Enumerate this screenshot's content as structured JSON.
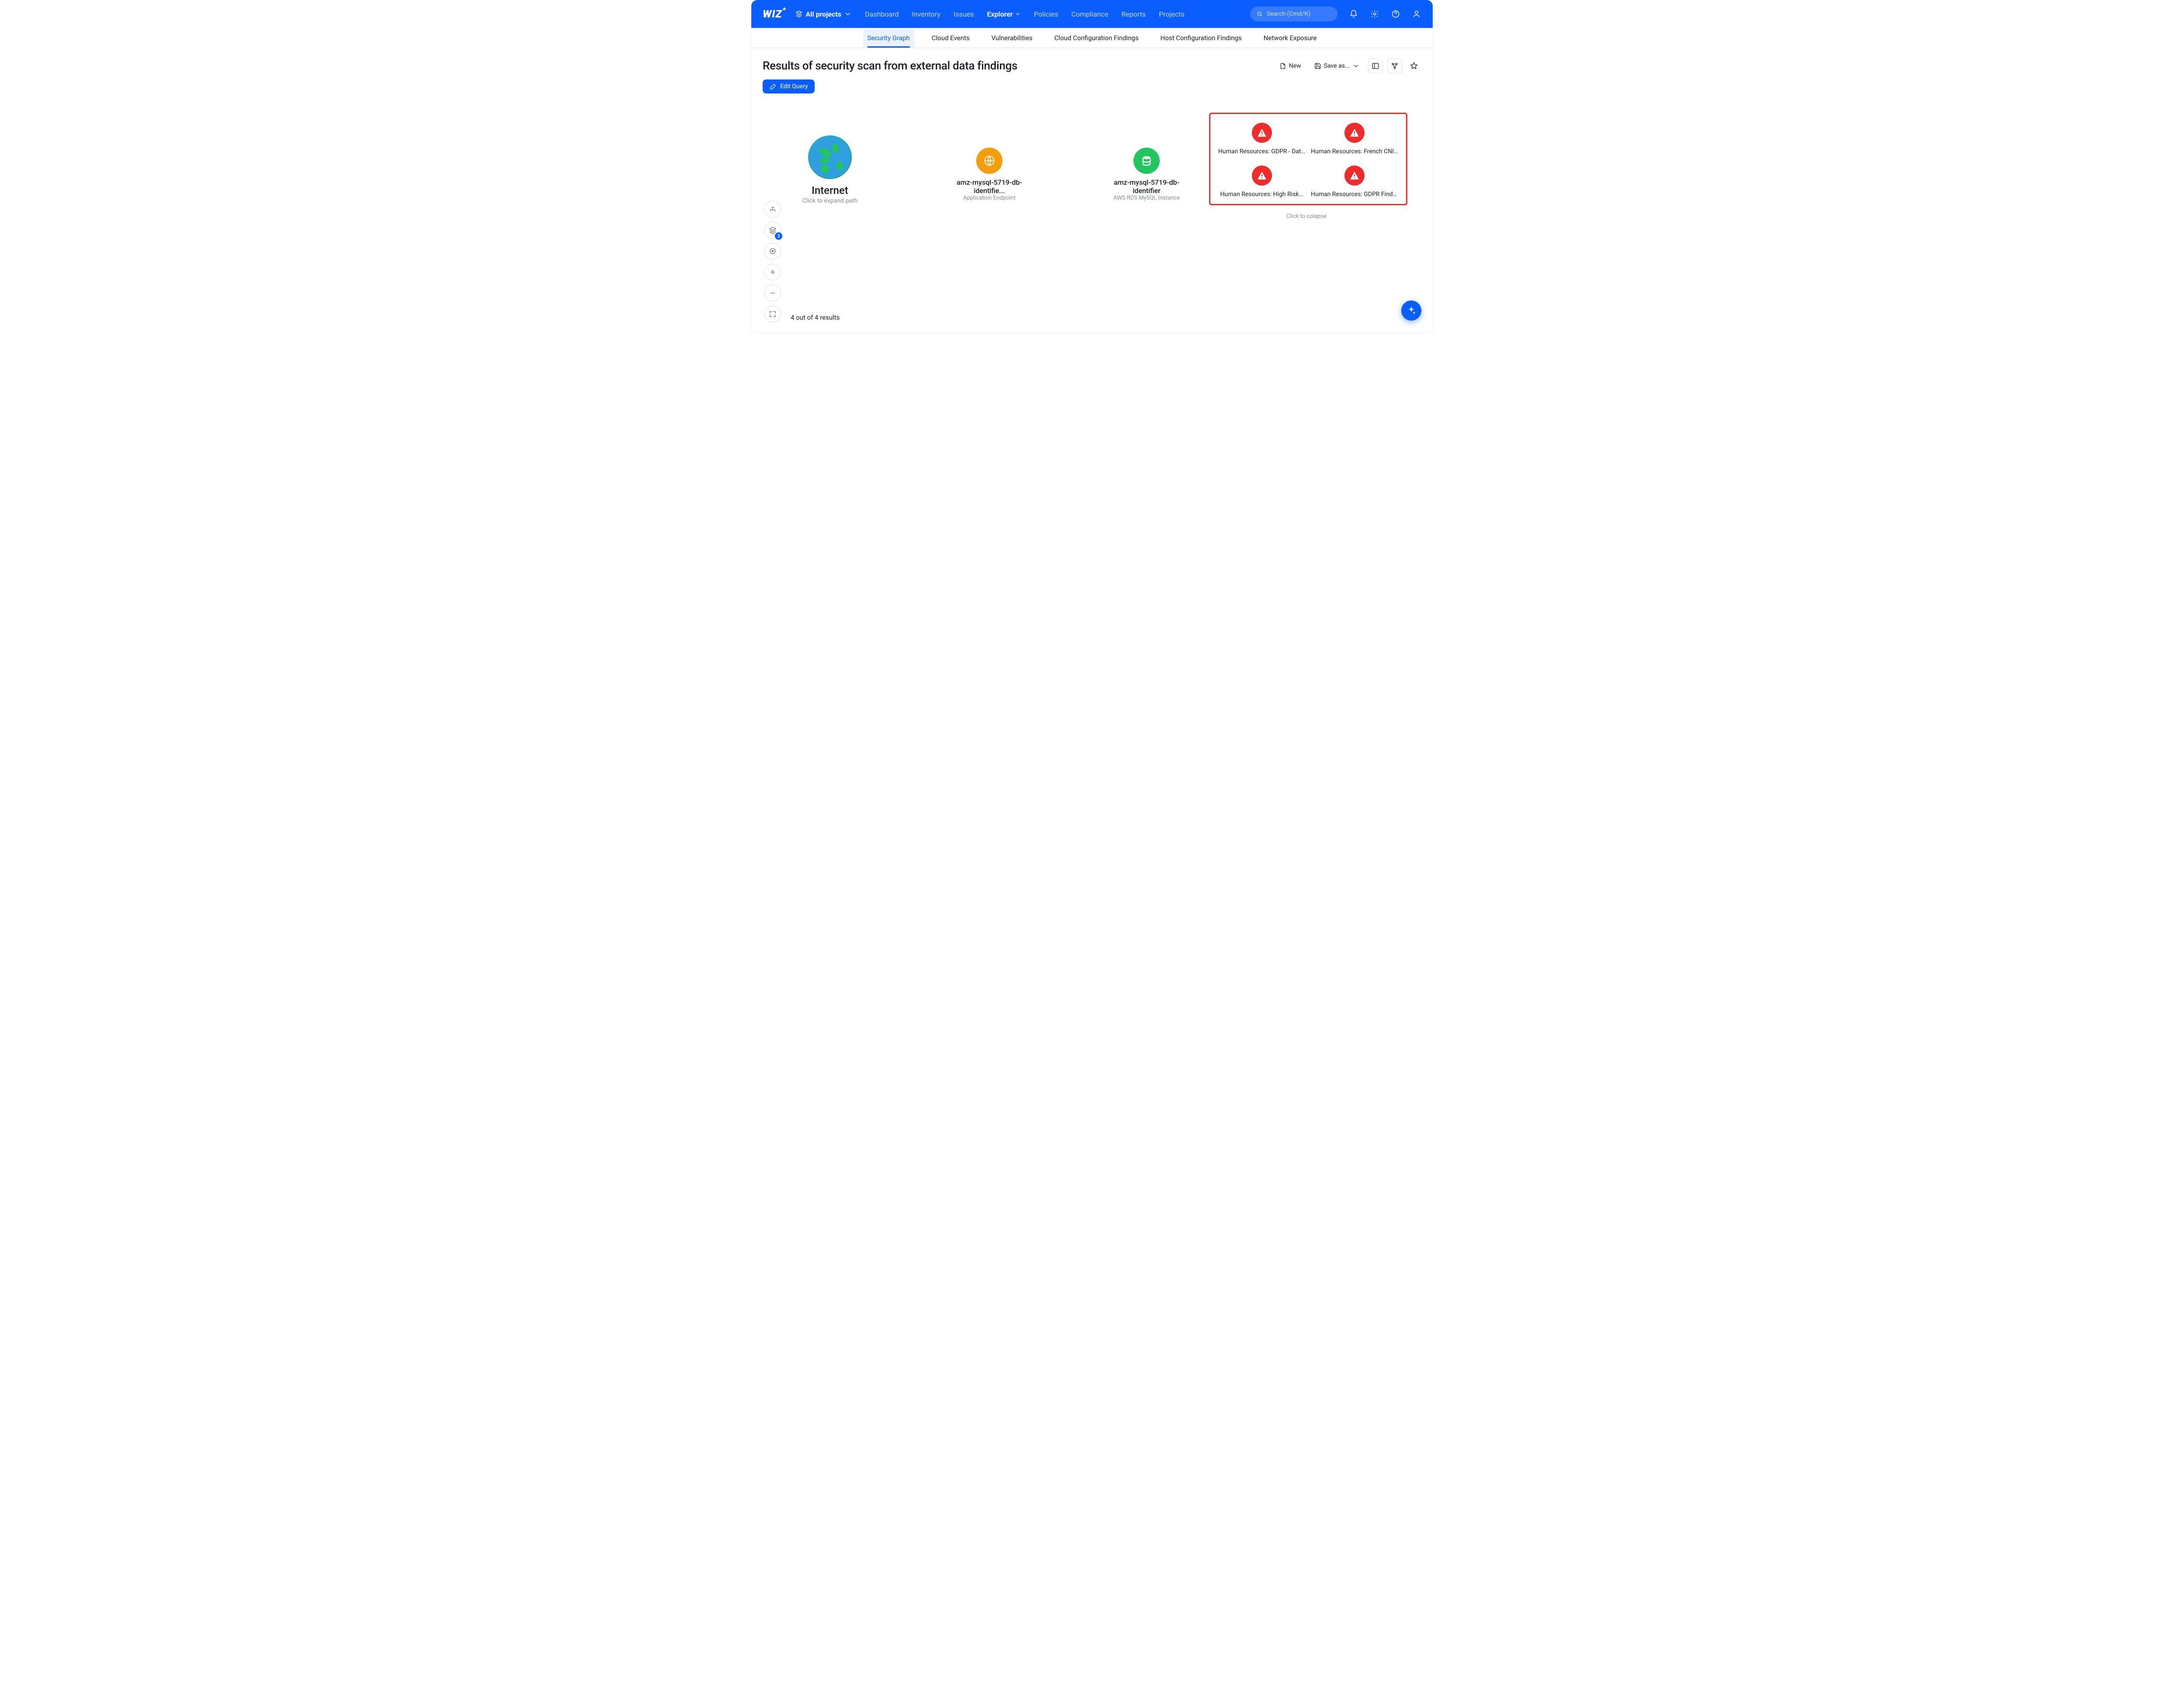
{
  "brand": "WIZ",
  "project_selector": {
    "label": "All projects"
  },
  "nav": {
    "items": [
      "Dashboard",
      "Inventory",
      "Issues",
      "Explorer",
      "Policies",
      "Compliance",
      "Reports",
      "Projects"
    ],
    "active": "Explorer"
  },
  "search": {
    "placeholder": "Search (Cmd/K)"
  },
  "tabs": {
    "items": [
      "Security Graph",
      "Cloud Events",
      "Vulnerabilities",
      "Cloud Configuration Findings",
      "Host Configuration Findings",
      "Network Exposure"
    ],
    "active": "Security Graph"
  },
  "page": {
    "title": "Results of security scan from external data findings",
    "new_btn": "New",
    "save_as_btn": "Save as...",
    "edit_query_btn": "Edit Query"
  },
  "graph": {
    "internet_node": {
      "title": "Internet",
      "subtitle": "Click to expand path"
    },
    "app_endpoint_node": {
      "title": "amz-mysql-5719-db-identifie...",
      "subtitle": "Application Endpoint"
    },
    "db_node": {
      "title": "amz-mysql-5719-db-identifier",
      "subtitle": "AWS RDS MySQL Instance"
    },
    "findings": [
      "Human Resources: GDPR - Dat...",
      "Human Resources: French CNI...",
      "Human Resources: High Risk...",
      "Human Resources: GDPR Findings"
    ],
    "collapse_hint": "Click to colapse",
    "layers_badge": "2",
    "results_count": "4 out of 4 results"
  },
  "colors": {
    "primary": "#0a5dff",
    "edge_orange": "#f59e0b",
    "edge_green": "#22c55e",
    "danger": "#ef2c2c"
  }
}
